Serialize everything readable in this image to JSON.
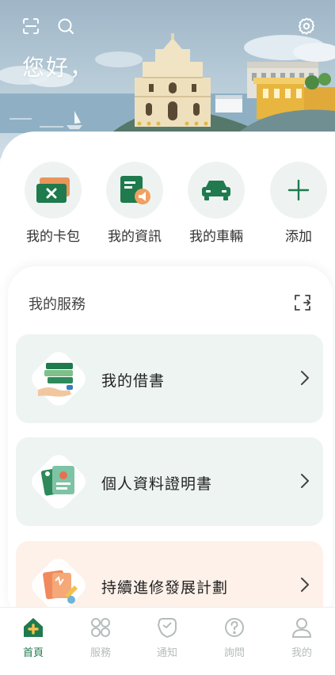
{
  "header": {
    "greeting": "您好，",
    "icons": [
      "scan-icon",
      "search-icon",
      "settings-icon"
    ]
  },
  "quick_actions": [
    {
      "label": "我的卡包",
      "icon": "card-wallet-icon"
    },
    {
      "label": "我的資訊",
      "icon": "info-announcement-icon"
    },
    {
      "label": "我的車輛",
      "icon": "car-icon"
    },
    {
      "label": "添加",
      "icon": "plus-icon"
    }
  ],
  "services": {
    "title": "我的服務",
    "items": [
      {
        "label": "我的借書",
        "icon": "books-icon",
        "bg": "#eef4f1"
      },
      {
        "label": "個人資料證明書",
        "icon": "id-certificate-icon",
        "bg": "#eef4f1"
      },
      {
        "label": "持續進修發展計劃",
        "icon": "study-program-icon",
        "bg": "#fdf1ea"
      }
    ]
  },
  "bottom_nav": [
    {
      "label": "首頁",
      "icon": "home-icon",
      "active": true
    },
    {
      "label": "服務",
      "icon": "grid-icon",
      "active": false
    },
    {
      "label": "通知",
      "icon": "notification-icon",
      "active": false
    },
    {
      "label": "詢問",
      "icon": "question-icon",
      "active": false
    },
    {
      "label": "我的",
      "icon": "profile-icon",
      "active": false
    }
  ],
  "colors": {
    "brand_green": "#1f7a4d",
    "service_green_bg": "#eef4f1",
    "service_peach_bg": "#fdf1ea",
    "inactive_nav": "#b5bcbc"
  }
}
